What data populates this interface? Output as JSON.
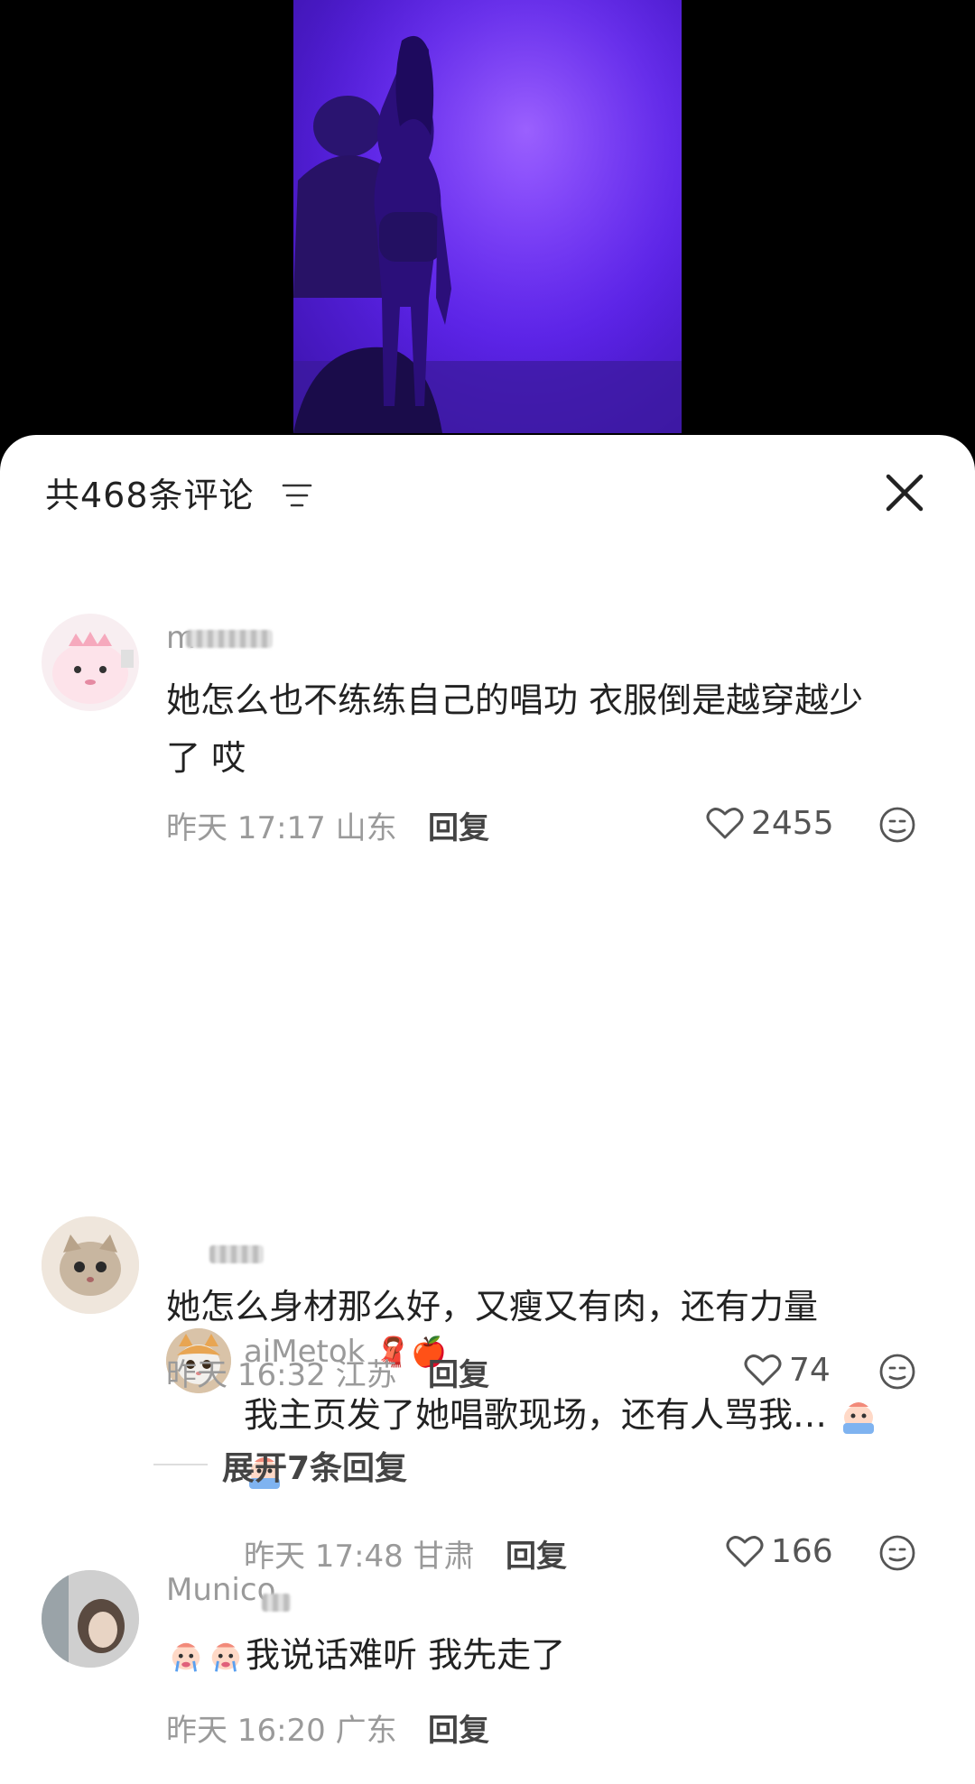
{
  "header": {
    "count_text": "共468条评论"
  },
  "comments": [
    {
      "username": "m",
      "text_line1": "她怎么也不练练自己的唱功 衣服倒是越穿越少",
      "text_line2": "了 哎",
      "date": "昨天 17:17 山东",
      "reply_label": "回复",
      "likes": "2455",
      "replies": [
        {
          "username": "aiMetok",
          "username_emojis": "🧣🍎",
          "text_line1": "我主页发了她唱歌现场，还有人骂我…",
          "date": "昨天 17:48 甘肃",
          "reply_label": "回复",
          "likes": "166"
        }
      ]
    },
    {
      "username": "",
      "text_line1": "她怎么身材那么好，又瘦又有肉，还有力量",
      "date": "昨天 16:32 江苏",
      "reply_label": "回复",
      "likes": "74",
      "expand_label": "展开7条回复"
    },
    {
      "username": "Munico",
      "text_line1": "我说话难听 我先走了",
      "date": "昨天 16:20 广东",
      "reply_label": "回复"
    }
  ],
  "colors": {
    "stage_purple": "#5a22e6",
    "sheet_bg": "#ffffff",
    "text_primary": "#222222",
    "text_meta": "#9a9a9a"
  },
  "icons": [
    "sort-icon",
    "close-icon",
    "heart-icon",
    "emoji-icon",
    "crying-emoji-icon",
    "scarf-emoji",
    "apple-emoji"
  ]
}
